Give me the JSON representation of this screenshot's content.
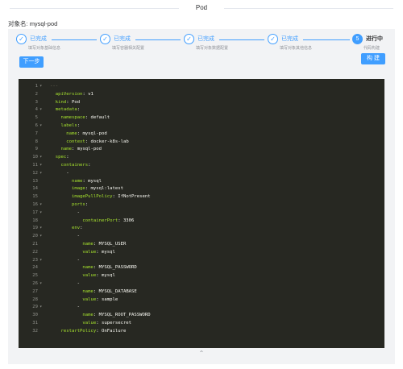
{
  "header": {
    "title": "Pod"
  },
  "object": {
    "label": "对象名:",
    "value": "mysql-pod"
  },
  "steps": [
    {
      "status": "已完成",
      "desc": "填写对象基础信息",
      "icon": "check-icon"
    },
    {
      "status": "已完成",
      "desc": "填写容器相关配置",
      "icon": "check-icon"
    },
    {
      "status": "已完成",
      "desc": "填写对象数据配置",
      "icon": "check-icon"
    },
    {
      "status": "已完成",
      "desc": "填写对象其他信息",
      "icon": "check-icon"
    },
    {
      "number": "5",
      "status": "进行中",
      "desc": "代码构建"
    }
  ],
  "buttons": {
    "next": "下一步",
    "build": "构 建"
  },
  "editor": {
    "lines": [
      {
        "n": "1",
        "fold": "▾",
        "code": [
          [
            "c",
            "---"
          ]
        ]
      },
      {
        "n": "2",
        "fold": "",
        "code": [
          [
            "p",
            "  "
          ],
          [
            "k",
            "apiVersion"
          ],
          [
            "p",
            ": v1"
          ]
        ]
      },
      {
        "n": "3",
        "fold": "",
        "code": [
          [
            "p",
            "  "
          ],
          [
            "k",
            "kind"
          ],
          [
            "p",
            ": Pod"
          ]
        ]
      },
      {
        "n": "4",
        "fold": "▾",
        "code": [
          [
            "p",
            "  "
          ],
          [
            "k",
            "metadata"
          ],
          [
            "p",
            ":"
          ]
        ]
      },
      {
        "n": "5",
        "fold": "",
        "code": [
          [
            "p",
            "    "
          ],
          [
            "k",
            "namespace"
          ],
          [
            "p",
            ": default"
          ]
        ]
      },
      {
        "n": "6",
        "fold": "▾",
        "code": [
          [
            "p",
            "    "
          ],
          [
            "k",
            "labels"
          ],
          [
            "p",
            ":"
          ]
        ]
      },
      {
        "n": "7",
        "fold": "",
        "code": [
          [
            "p",
            "      "
          ],
          [
            "k",
            "name"
          ],
          [
            "p",
            ": mysql-pod"
          ]
        ]
      },
      {
        "n": "8",
        "fold": "",
        "code": [
          [
            "p",
            "      "
          ],
          [
            "k",
            "context"
          ],
          [
            "p",
            ": docker-k8s-lab"
          ]
        ]
      },
      {
        "n": "9",
        "fold": "",
        "code": [
          [
            "p",
            "    "
          ],
          [
            "k",
            "name"
          ],
          [
            "p",
            ": mysql-pod"
          ]
        ]
      },
      {
        "n": "10",
        "fold": "▾",
        "code": [
          [
            "p",
            "  "
          ],
          [
            "k",
            "spec"
          ],
          [
            "p",
            ":"
          ]
        ]
      },
      {
        "n": "11",
        "fold": "▾",
        "code": [
          [
            "p",
            "    "
          ],
          [
            "k",
            "containers"
          ],
          [
            "p",
            ":"
          ]
        ]
      },
      {
        "n": "12",
        "fold": "▾",
        "code": [
          [
            "p",
            "      -"
          ]
        ]
      },
      {
        "n": "13",
        "fold": "",
        "code": [
          [
            "p",
            "        "
          ],
          [
            "k",
            "name"
          ],
          [
            "p",
            ": mysql"
          ]
        ]
      },
      {
        "n": "14",
        "fold": "",
        "code": [
          [
            "p",
            "        "
          ],
          [
            "k",
            "image"
          ],
          [
            "p",
            ": mysql:latest"
          ]
        ]
      },
      {
        "n": "15",
        "fold": "",
        "code": [
          [
            "p",
            "        "
          ],
          [
            "k",
            "imagePullPolicy"
          ],
          [
            "p",
            ": IfNotPresent"
          ]
        ]
      },
      {
        "n": "16",
        "fold": "▾",
        "code": [
          [
            "p",
            "        "
          ],
          [
            "k",
            "ports"
          ],
          [
            "p",
            ":"
          ]
        ]
      },
      {
        "n": "17",
        "fold": "▾",
        "code": [
          [
            "p",
            "          -"
          ]
        ]
      },
      {
        "n": "18",
        "fold": "",
        "code": [
          [
            "p",
            "            "
          ],
          [
            "k",
            "containerPort"
          ],
          [
            "p",
            ": 3306"
          ]
        ]
      },
      {
        "n": "19",
        "fold": "▾",
        "code": [
          [
            "p",
            "        "
          ],
          [
            "k",
            "env"
          ],
          [
            "p",
            ":"
          ]
        ]
      },
      {
        "n": "20",
        "fold": "▾",
        "code": [
          [
            "p",
            "          -"
          ]
        ]
      },
      {
        "n": "21",
        "fold": "",
        "code": [
          [
            "p",
            "            "
          ],
          [
            "k",
            "name"
          ],
          [
            "p",
            ": MYSQL_USER"
          ]
        ]
      },
      {
        "n": "22",
        "fold": "",
        "code": [
          [
            "p",
            "            "
          ],
          [
            "k",
            "value"
          ],
          [
            "p",
            ": mysql"
          ]
        ]
      },
      {
        "n": "23",
        "fold": "▾",
        "code": [
          [
            "p",
            "          -"
          ]
        ]
      },
      {
        "n": "24",
        "fold": "",
        "code": [
          [
            "p",
            "            "
          ],
          [
            "k",
            "name"
          ],
          [
            "p",
            ": MYSQL_PASSWORD"
          ]
        ]
      },
      {
        "n": "25",
        "fold": "",
        "code": [
          [
            "p",
            "            "
          ],
          [
            "k",
            "value"
          ],
          [
            "p",
            ": mysql"
          ]
        ]
      },
      {
        "n": "26",
        "fold": "▾",
        "code": [
          [
            "p",
            "          -"
          ]
        ]
      },
      {
        "n": "27",
        "fold": "",
        "code": [
          [
            "p",
            "            "
          ],
          [
            "k",
            "name"
          ],
          [
            "p",
            ": MYSQL_DATABASE"
          ]
        ]
      },
      {
        "n": "28",
        "fold": "",
        "code": [
          [
            "p",
            "            "
          ],
          [
            "k",
            "value"
          ],
          [
            "p",
            ": sample"
          ]
        ]
      },
      {
        "n": "29",
        "fold": "▾",
        "code": [
          [
            "p",
            "          -"
          ]
        ]
      },
      {
        "n": "30",
        "fold": "",
        "code": [
          [
            "p",
            "            "
          ],
          [
            "k",
            "name"
          ],
          [
            "p",
            ": MYSQL_ROOT_PASSWORD"
          ]
        ]
      },
      {
        "n": "31",
        "fold": "",
        "code": [
          [
            "p",
            "            "
          ],
          [
            "k",
            "value"
          ],
          [
            "p",
            ": supersecret"
          ]
        ]
      },
      {
        "n": "32",
        "fold": "",
        "code": [
          [
            "p",
            "    "
          ],
          [
            "k",
            "restartPolicy"
          ],
          [
            "p",
            ": OnFailure"
          ]
        ]
      }
    ]
  },
  "collapse_icon": "chevron-up-icon",
  "colors": {
    "primary": "#409eff",
    "editor_bg": "#272822",
    "key": "#a6e22e",
    "text": "#f8f8f2",
    "line_number": "#8f908a",
    "panel_bg": "#f2f3f5"
  }
}
